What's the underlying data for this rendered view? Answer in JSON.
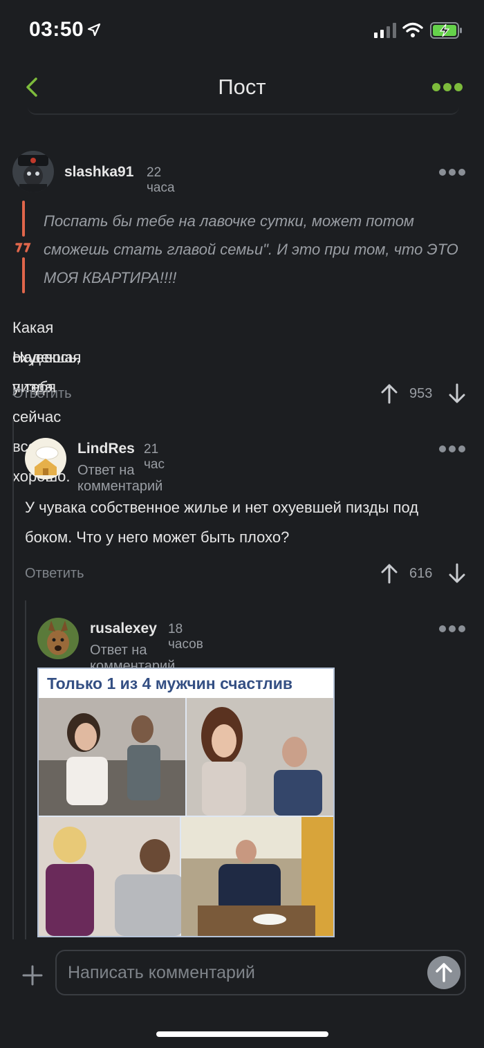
{
  "status_bar": {
    "time": "03:50",
    "icons": [
      "location-arrow-icon",
      "cellular-signal-icon",
      "wifi-icon",
      "battery-charging-icon"
    ]
  },
  "navbar": {
    "title": "Пост",
    "back_icon": "chevron-left-icon",
    "more_icon": "ellipsis-icon"
  },
  "colors": {
    "background": "#1c1e21",
    "accent_green": "#7dbb3c",
    "quote_bar": "#e0664b",
    "muted_text": "#9a9ea4"
  },
  "comments": [
    {
      "author": "slashka91",
      "time_ago": "22 часа",
      "quote": "Поспать бы тебе на лавочке сутки, может потом сможешь стать главой семьи\". И это при том, что ЭТО МОЯ КВАРТИРА!!!!",
      "text_lines": [
        "Какая охуевшая пизда.",
        "Надеюсь, у тебя сейчас все хорошо."
      ],
      "reply_label": "Ответить",
      "votes": "953"
    },
    {
      "author": "LindRes",
      "time_ago": "21 час",
      "reply_to": "Ответ на комментарий",
      "text": "У чувака собственное жилье и нет охуевшей пизды под боком. Что у него может быть плохо?",
      "reply_label": "Ответить",
      "votes": "616"
    },
    {
      "author": "rusalexey",
      "time_ago": "18 часов",
      "reply_to": "Ответ на комментарий",
      "image_caption": "Только 1 из 4 мужчин счастлив"
    }
  ],
  "composer": {
    "placeholder": "Написать комментарий",
    "plus_icon": "plus-icon",
    "send_icon": "arrow-up-icon"
  }
}
